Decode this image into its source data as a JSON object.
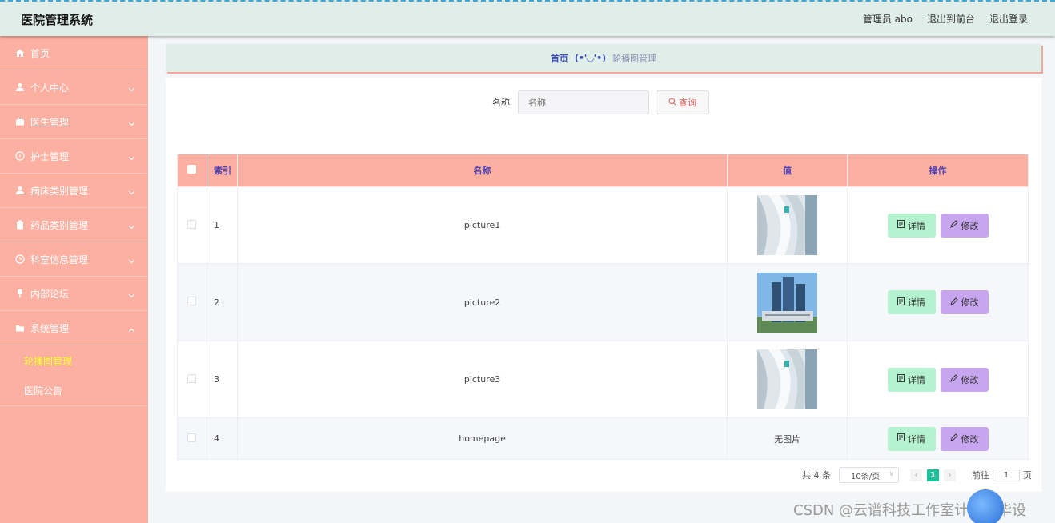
{
  "app": {
    "title": "医院管理系统"
  },
  "header": {
    "user_label": "管理员 abo",
    "front_link": "退出到前台",
    "logout_link": "退出登录"
  },
  "sidebar": {
    "items": [
      {
        "label": "首页",
        "icon": "home-icon"
      },
      {
        "label": "个人中心",
        "icon": "user-icon"
      },
      {
        "label": "医生管理",
        "icon": "briefcase-icon"
      },
      {
        "label": "护士管理",
        "icon": "compass-icon"
      },
      {
        "label": "病床类别管理",
        "icon": "user-icon"
      },
      {
        "label": "药品类别管理",
        "icon": "clipboard-icon"
      },
      {
        "label": "科室信息管理",
        "icon": "clock-icon"
      },
      {
        "label": "内部论坛",
        "icon": "pin-icon"
      },
      {
        "label": "系统管理",
        "icon": "folder-icon"
      }
    ],
    "sub_items": [
      {
        "label": "轮播图管理"
      },
      {
        "label": "医院公告"
      }
    ]
  },
  "breadcrumb": {
    "home": "首页",
    "face": "(•'◡'•)",
    "current": "轮播图管理"
  },
  "search": {
    "label": "名称",
    "placeholder": "名称",
    "button": "查询"
  },
  "table": {
    "headers": {
      "index": "索引",
      "name": "名称",
      "value": "值",
      "actions": "操作"
    },
    "rows": [
      {
        "index": "1",
        "name": "picture1",
        "value": "",
        "image": "white-curves"
      },
      {
        "index": "2",
        "name": "picture2",
        "value": "",
        "image": "hospital-building"
      },
      {
        "index": "3",
        "name": "picture3",
        "value": "",
        "image": "white-curves"
      },
      {
        "index": "4",
        "name": "homepage",
        "value": "无图片",
        "image": ""
      }
    ],
    "detail_label": "详情",
    "edit_label": "修改"
  },
  "pagination": {
    "total": "共 4 条",
    "page_size": "10条/页",
    "current_page": "1",
    "goto_label": "前往",
    "goto_value": "1",
    "page_suffix": "页"
  },
  "watermark": "CSDN @云谱科技工作室计算机毕设",
  "colors": {
    "sidebar": "#fbb0a2",
    "header": "#dfeee8",
    "detail_button": "#b5f2cf",
    "edit_button": "#c8a6ef",
    "active_page": "#1cc09a"
  }
}
